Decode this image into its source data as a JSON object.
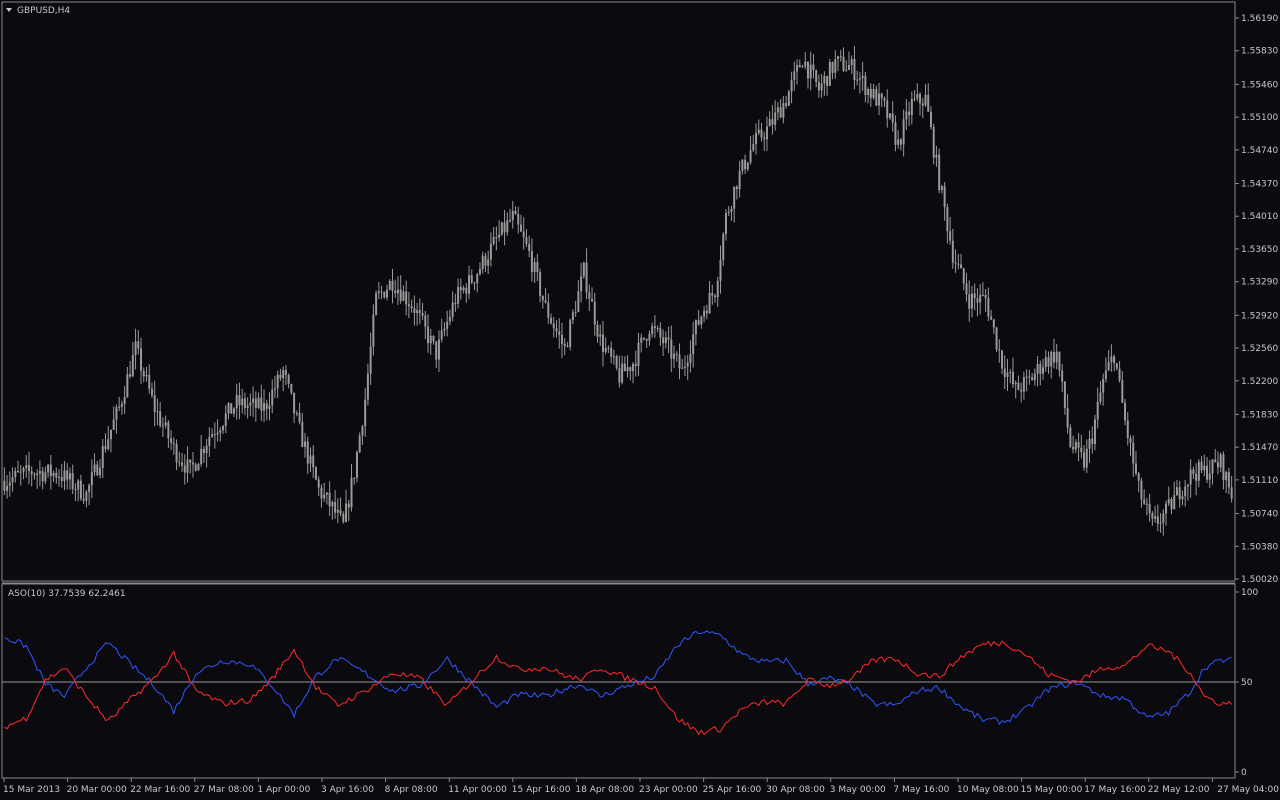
{
  "chart_title": "GBPUSD,H4",
  "indicator_label": "ASO(10) 37.7539 62.2461",
  "colors": {
    "background": "#0a0a0f",
    "candles": "#9a9a9a",
    "frame": "#8a8a8a",
    "text": "#c8c8c8",
    "bull_line": "#3355ff",
    "bear_line": "#ff2a2a",
    "level_line": "#9a9a9a"
  },
  "icons": {
    "timeframe_menu": "triangle-down-icon"
  },
  "chart_data": [
    {
      "type": "candlestick",
      "title": "GBPUSD,H4",
      "ylim": [
        1.5002,
        1.5619
      ],
      "y_ticks": [
        "1.56190",
        "1.55830",
        "1.55460",
        "1.55100",
        "1.54740",
        "1.54370",
        "1.54010",
        "1.53650",
        "1.53290",
        "1.52920",
        "1.52560",
        "1.52200",
        "1.51830",
        "1.51470",
        "1.51110",
        "1.50740",
        "1.50380",
        "1.50020"
      ],
      "x_ticks": [
        "15 Mar 2013",
        "20 Mar 00:00",
        "22 Mar 16:00",
        "27 Mar 08:00",
        "1 Apr 00:00",
        "3 Apr 16:00",
        "8 Apr 08:00",
        "11 Apr 00:00",
        "15 Apr 16:00",
        "18 Apr 08:00",
        "23 Apr 00:00",
        "25 Apr 16:00",
        "30 Apr 08:00",
        "3 May 00:00",
        "7 May 16:00",
        "10 May 08:00",
        "15 May 00:00",
        "17 May 16:00",
        "22 May 12:00",
        "27 May 04:00"
      ],
      "close_path": [
        [
          0,
          1.511
        ],
        [
          10,
          1.512
        ],
        [
          20,
          1.5118
        ],
        [
          30,
          1.5095
        ],
        [
          35,
          1.5135
        ],
        [
          42,
          1.519
        ],
        [
          48,
          1.5255
        ],
        [
          55,
          1.519
        ],
        [
          62,
          1.5145
        ],
        [
          68,
          1.512
        ],
        [
          75,
          1.516
        ],
        [
          85,
          1.5195
        ],
        [
          95,
          1.519
        ],
        [
          102,
          1.523
        ],
        [
          108,
          1.5165
        ],
        [
          115,
          1.51
        ],
        [
          120,
          1.508
        ],
        [
          124,
          1.506
        ],
        [
          128,
          1.512
        ],
        [
          132,
          1.52
        ],
        [
          136,
          1.531
        ],
        [
          142,
          1.533
        ],
        [
          150,
          1.53
        ],
        [
          158,
          1.525
        ],
        [
          165,
          1.531
        ],
        [
          172,
          1.5335
        ],
        [
          180,
          1.5375
        ],
        [
          186,
          1.54
        ],
        [
          192,
          1.536
        ],
        [
          198,
          1.53
        ],
        [
          205,
          1.5255
        ],
        [
          212,
          1.534
        ],
        [
          218,
          1.5265
        ],
        [
          225,
          1.5225
        ],
        [
          230,
          1.524
        ],
        [
          236,
          1.528
        ],
        [
          242,
          1.526
        ],
        [
          248,
          1.523
        ],
        [
          252,
          1.527
        ],
        [
          256,
          1.53
        ],
        [
          260,
          1.532
        ],
        [
          264,
          1.54
        ],
        [
          268,
          1.544
        ],
        [
          274,
          1.548
        ],
        [
          280,
          1.55
        ],
        [
          286,
          1.553
        ],
        [
          292,
          1.5575
        ],
        [
          298,
          1.554
        ],
        [
          304,
          1.557
        ],
        [
          310,
          1.5565
        ],
        [
          316,
          1.554
        ],
        [
          322,
          1.552
        ],
        [
          327,
          1.548
        ],
        [
          332,
          1.5525
        ],
        [
          337,
          1.553
        ],
        [
          342,
          1.544
        ],
        [
          347,
          1.536
        ],
        [
          353,
          1.531
        ],
        [
          359,
          1.531
        ],
        [
          365,
          1.524
        ],
        [
          370,
          1.521
        ],
        [
          375,
          1.522
        ],
        [
          380,
          1.524
        ],
        [
          385,
          1.525
        ],
        [
          390,
          1.515
        ],
        [
          395,
          1.513
        ],
        [
          398,
          1.516
        ],
        [
          402,
          1.522
        ],
        [
          406,
          1.525
        ],
        [
          410,
          1.5175
        ],
        [
          415,
          1.51
        ],
        [
          420,
          1.506
        ],
        [
          425,
          1.5075
        ],
        [
          430,
          1.51
        ],
        [
          435,
          1.512
        ],
        [
          439,
          1.512
        ],
        [
          445,
          1.513
        ],
        [
          449,
          1.5095
        ]
      ]
    },
    {
      "type": "line",
      "title": "ASO(10) 37.7539 62.2461",
      "ylim": [
        0,
        100
      ],
      "y_ticks": [
        "100",
        "50",
        "0"
      ],
      "level": 50,
      "series": [
        {
          "color": "#3355ff",
          "points": [
            [
              0,
              75
            ],
            [
              8,
              70
            ],
            [
              15,
              49
            ],
            [
              22,
              42
            ],
            [
              30,
              58
            ],
            [
              38,
              72
            ],
            [
              46,
              60
            ],
            [
              55,
              48
            ],
            [
              62,
              34
            ],
            [
              70,
              55
            ],
            [
              80,
              62
            ],
            [
              90,
              60
            ],
            [
              98,
              48
            ],
            [
              106,
              32
            ],
            [
              114,
              53
            ],
            [
              122,
              63
            ],
            [
              132,
              55
            ],
            [
              142,
              45
            ],
            [
              152,
              48
            ],
            [
              162,
              63
            ],
            [
              172,
              48
            ],
            [
              180,
              36
            ],
            [
              188,
              43
            ],
            [
              198,
              42
            ],
            [
              208,
              48
            ],
            [
              212,
              48
            ],
            [
              218,
              42
            ],
            [
              228,
              48
            ],
            [
              238,
              53
            ],
            [
              246,
              70
            ],
            [
              254,
              78
            ],
            [
              262,
              76
            ],
            [
              270,
              65
            ],
            [
              278,
              61
            ],
            [
              286,
              62
            ],
            [
              294,
              49
            ],
            [
              302,
              52
            ],
            [
              310,
              48
            ],
            [
              318,
              38
            ],
            [
              326,
              37
            ],
            [
              334,
              45
            ],
            [
              342,
              47
            ],
            [
              350,
              36
            ],
            [
              358,
              29
            ],
            [
              366,
              28
            ],
            [
              374,
              35
            ],
            [
              382,
              46
            ],
            [
              392,
              50
            ],
            [
              402,
              42
            ],
            [
              410,
              41
            ],
            [
              418,
              30
            ],
            [
              426,
              33
            ],
            [
              434,
              45
            ],
            [
              439,
              58
            ],
            [
              445,
              62
            ]
          ]
        },
        {
          "color": "#ff2a2a",
          "name": "",
          "points": [
            [
              0,
              25
            ],
            [
              8,
              30
            ],
            [
              15,
              51
            ],
            [
              22,
              58
            ],
            [
              30,
              42
            ],
            [
              38,
              28
            ],
            [
              46,
              40
            ],
            [
              55,
              52
            ],
            [
              62,
              66
            ],
            [
              70,
              45
            ],
            [
              80,
              38
            ],
            [
              90,
              40
            ],
            [
              98,
              52
            ],
            [
              106,
              68
            ],
            [
              114,
              47
            ],
            [
              122,
              37
            ],
            [
              132,
              45
            ],
            [
              142,
              55
            ],
            [
              152,
              52
            ],
            [
              162,
              37
            ],
            [
              172,
              52
            ],
            [
              180,
              64
            ],
            [
              188,
              57
            ],
            [
              198,
              58
            ],
            [
              208,
              52
            ],
            [
              212,
              52
            ],
            [
              218,
              58
            ],
            [
              228,
              52
            ],
            [
              238,
              47
            ],
            [
              246,
              30
            ],
            [
              254,
              22
            ],
            [
              262,
              24
            ],
            [
              270,
              35
            ],
            [
              278,
              39
            ],
            [
              286,
              38
            ],
            [
              294,
              51
            ],
            [
              302,
              48
            ],
            [
              310,
              52
            ],
            [
              318,
              62
            ],
            [
              326,
              63
            ],
            [
              334,
              55
            ],
            [
              342,
              53
            ],
            [
              350,
              64
            ],
            [
              358,
              71
            ],
            [
              366,
              72
            ],
            [
              374,
              65
            ],
            [
              382,
              54
            ],
            [
              392,
              50
            ],
            [
              402,
              58
            ],
            [
              410,
              59
            ],
            [
              418,
              70
            ],
            [
              426,
              67
            ],
            [
              434,
              55
            ],
            [
              439,
              42
            ],
            [
              445,
              38
            ]
          ]
        }
      ]
    }
  ]
}
